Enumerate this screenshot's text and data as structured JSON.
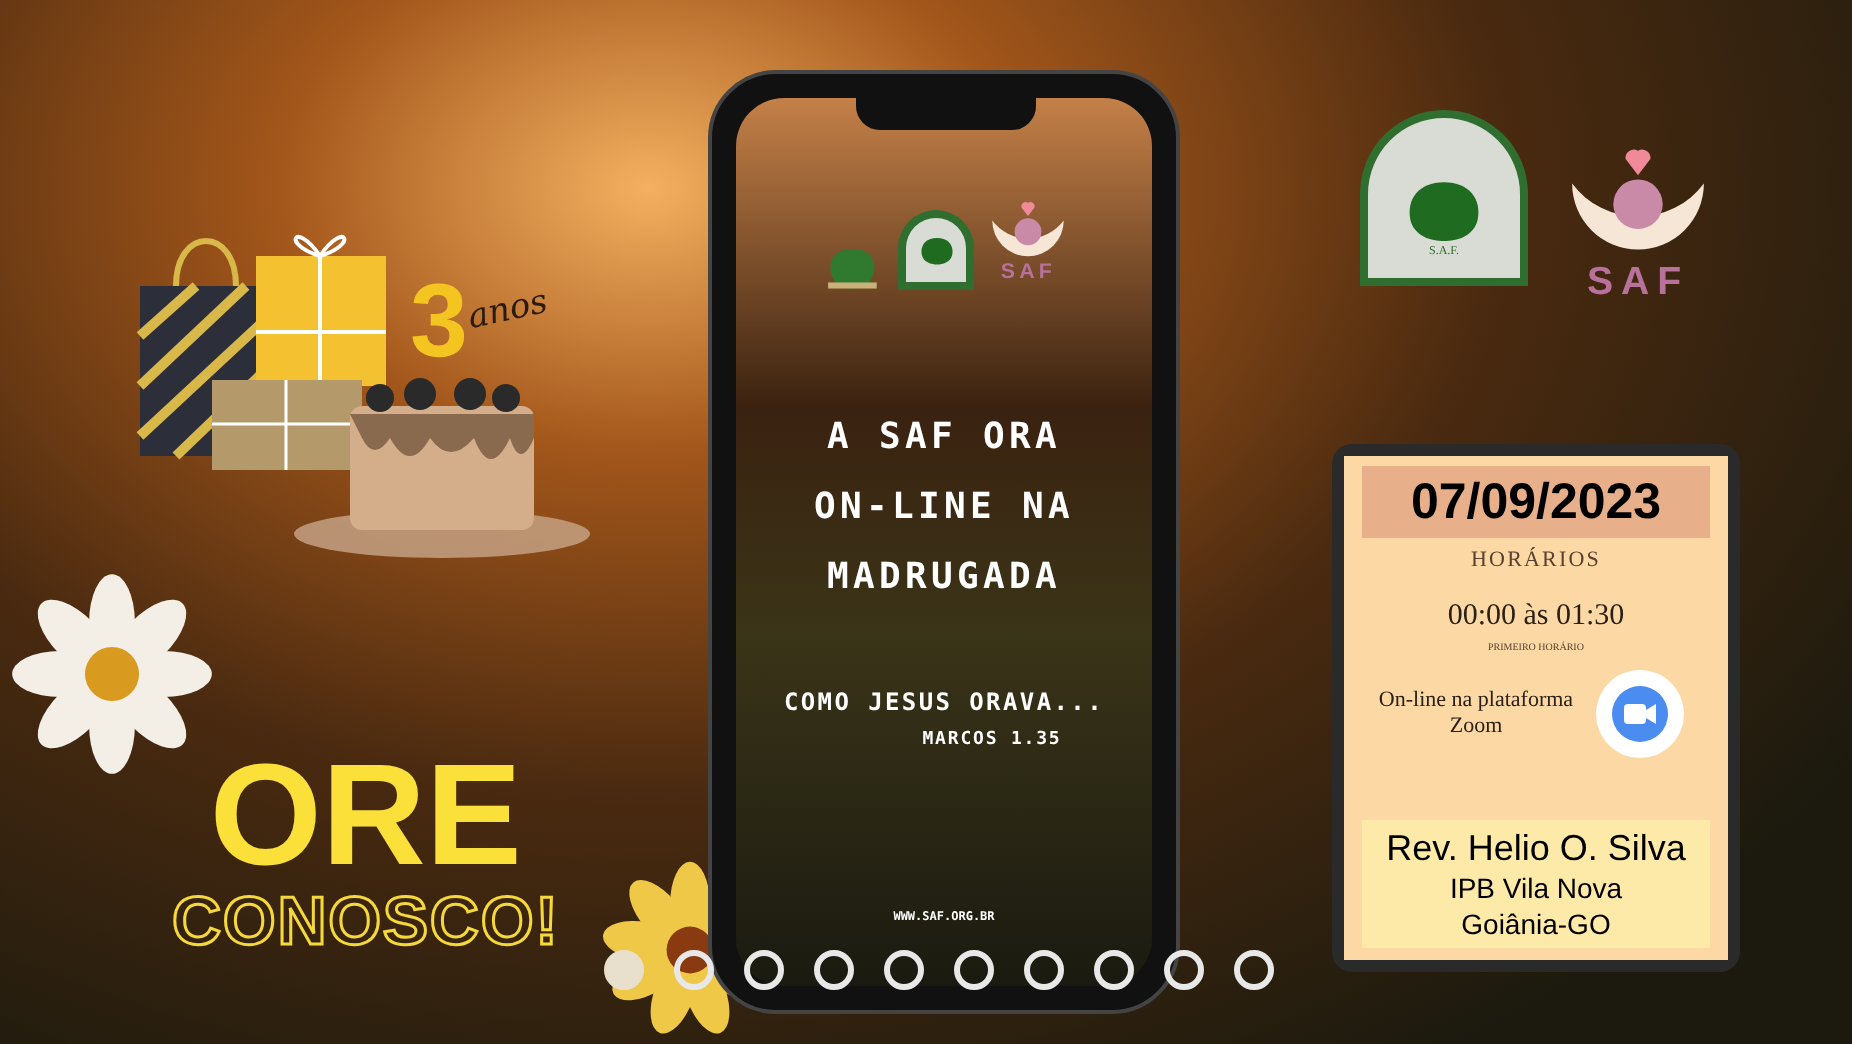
{
  "slide": {
    "birthday": {
      "number": "3",
      "caption": "anos"
    },
    "headline": "ORE",
    "subheadline": "CONOSCO!",
    "logos": [
      {
        "kind": "emblem",
        "label": "S.A.F."
      },
      {
        "kind": "woman",
        "label": "SAF"
      }
    ],
    "phone": {
      "logos": [
        {
          "kind": "tree"
        },
        {
          "kind": "emblem"
        },
        {
          "kind": "woman",
          "label": "SAF"
        }
      ],
      "title_lines": [
        "A SAF ORA",
        "ON-LINE NA",
        "MADRUGADA"
      ],
      "subtitle": "COMO JESUS ORAVA...",
      "reference": "MARCOS 1.35",
      "url": "WWW.SAF.ORG.BR"
    },
    "tablet": {
      "date": "07/09/2023",
      "heading": "HORÁRIOS",
      "time": "00:00 às 01:30",
      "time_caption": "PRIMEIRO HORÁRIO",
      "platform": "On-line na plataforma Zoom",
      "speaker": "Rev. Helio O. Silva",
      "church": "IPB Vila Nova",
      "city": "Goiânia-GO"
    }
  },
  "carousel": {
    "dots": [
      {
        "selected": true
      },
      {
        "selected": false
      },
      {
        "selected": false
      },
      {
        "selected": false
      },
      {
        "selected": false
      },
      {
        "selected": false
      },
      {
        "selected": false
      },
      {
        "selected": false
      },
      {
        "selected": false
      },
      {
        "selected": false
      }
    ]
  }
}
